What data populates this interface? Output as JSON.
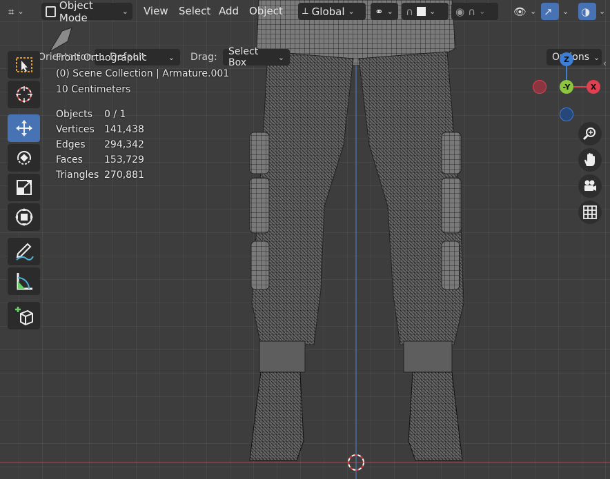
{
  "header": {
    "editor_icon": "object-mode-icon",
    "mode": "Object Mode",
    "menus": [
      "View",
      "Select",
      "Add",
      "Object"
    ],
    "transform_orientation": "Global"
  },
  "tool_header": {
    "orientation_label": "Orientation:",
    "orientation_value": "Default",
    "drag_label": "Drag:",
    "drag_value": "Select Box",
    "options_label": "Options"
  },
  "viewport": {
    "view_name": "Front Orthographic",
    "collection": "(0) Scene Collection | Armature.001",
    "scale": "10 Centimeters",
    "stats": [
      {
        "name": "Objects",
        "value": "0 / 1"
      },
      {
        "name": "Vertices",
        "value": "141,438"
      },
      {
        "name": "Edges",
        "value": "294,342"
      },
      {
        "name": "Faces",
        "value": "153,729"
      },
      {
        "name": "Triangles",
        "value": "270,881"
      }
    ]
  },
  "gizmo": {
    "z": "Z",
    "y": "-Y",
    "x": "X",
    "colors": {
      "x": "#e0404f",
      "y": "#8cc63f",
      "z": "#3d7fd6"
    }
  },
  "toolbar": [
    "select-box-icon",
    "cursor-icon",
    "move-icon",
    "rotate-icon",
    "scale-icon",
    "transform-icon",
    "annotate-icon",
    "measure-icon",
    "add-cube-icon"
  ],
  "colors": {
    "accent": "#4772b3",
    "panel": "#2b2b2b",
    "background": "#3d3d3d"
  }
}
